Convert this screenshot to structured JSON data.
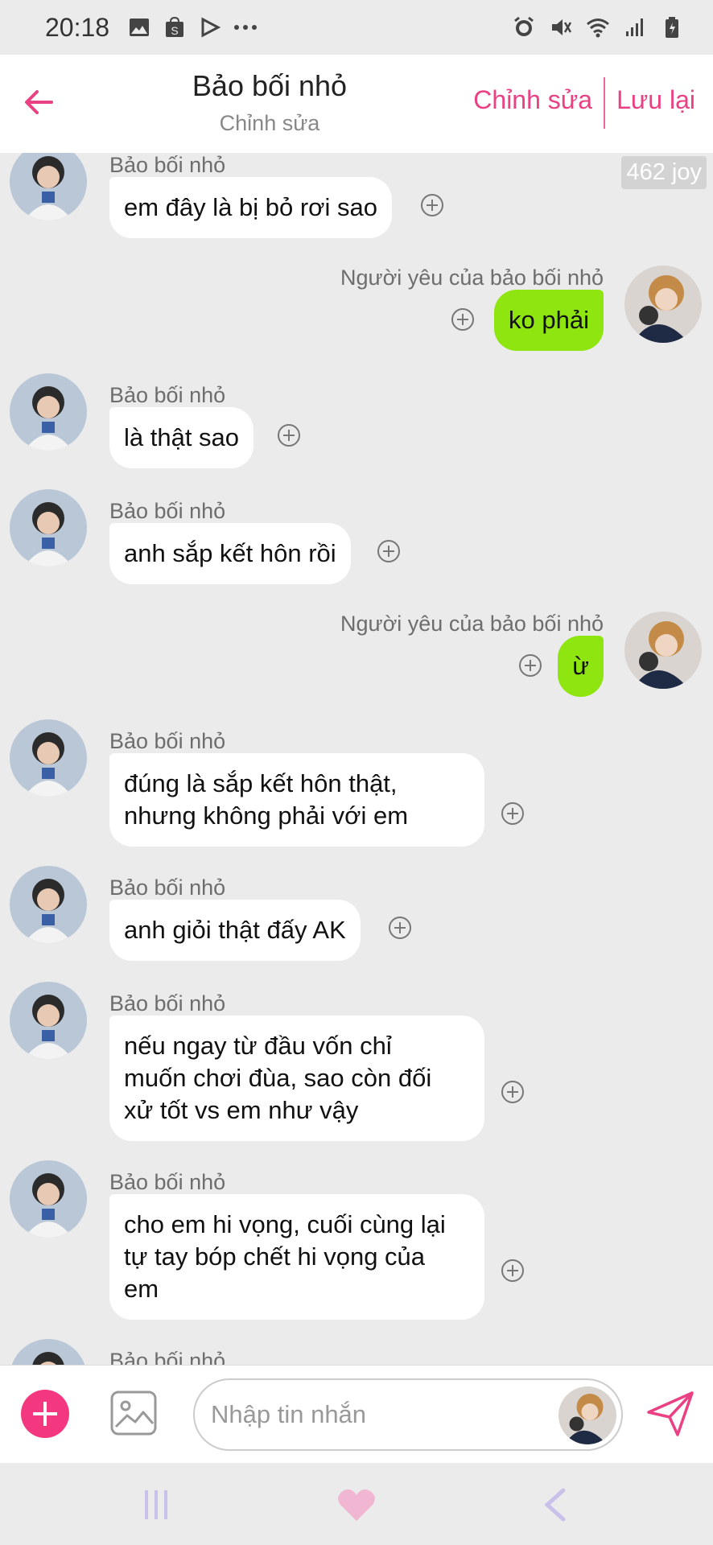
{
  "status_bar": {
    "time": "20:18",
    "left_icons": [
      "gallery-icon",
      "shop-icon",
      "play-icon",
      "more-dots-icon"
    ],
    "right_icons": [
      "alarm-icon",
      "mute-icon",
      "wifi-icon",
      "signal-icon",
      "battery-icon"
    ]
  },
  "header": {
    "title": "Bảo bối nhỏ",
    "subtitle": "Chỉnh sửa",
    "edit_label": "Chỉnh sửa",
    "save_label": "Lưu lại",
    "accent": "#e94183"
  },
  "badge": {
    "label": "462 joy"
  },
  "messages": [
    {
      "side": "left",
      "name": "Bảo bối nhỏ",
      "text": "em đây là bị bỏ rơi sao"
    },
    {
      "side": "right",
      "name": "Người yêu của bảo bối nhỏ",
      "text": "ko phải"
    },
    {
      "side": "left",
      "name": "Bảo bối nhỏ",
      "text": "là thật sao"
    },
    {
      "side": "left",
      "name": "Bảo bối nhỏ",
      "text": "anh sắp kết hôn rồi"
    },
    {
      "side": "right",
      "name": "Người yêu của bảo bối nhỏ",
      "text": "ừ"
    },
    {
      "side": "left",
      "name": "Bảo bối nhỏ",
      "lines": [
        "đúng là sắp kết hôn thật,",
        "nhưng không phải với em"
      ]
    },
    {
      "side": "left",
      "name": "Bảo bối nhỏ",
      "text": "anh giỏi thật đấy AK"
    },
    {
      "side": "left",
      "name": "Bảo bối nhỏ",
      "lines": [
        "nếu ngay từ đầu vốn chỉ",
        "muốn chơi đùa, sao còn đối",
        "xử tốt vs em như vậy"
      ]
    },
    {
      "side": "left",
      "name": "Bảo bối nhỏ",
      "lines": [
        "cho em hi vọng, cuối cùng lại",
        "tự tay bóp chết hi vọng của",
        "em"
      ]
    },
    {
      "side": "left",
      "name": "Bảo bối nhỏ"
    }
  ],
  "input": {
    "placeholder": "Nhập tin nhắn"
  },
  "colors": {
    "left_bubble": "#ffffff",
    "right_bubble": "#8ee510",
    "add_button": "#f4387f",
    "background": "#ebebeb"
  }
}
